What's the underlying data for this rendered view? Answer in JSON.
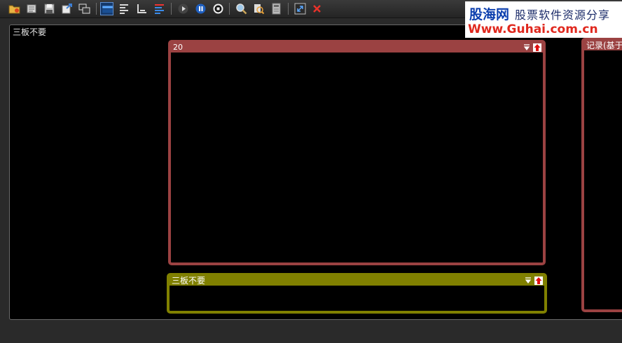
{
  "toolbar": {
    "buttons": [
      {
        "icon": "open-folder-icon"
      },
      {
        "icon": "open-icon"
      },
      {
        "icon": "save-icon"
      },
      {
        "icon": "export-icon"
      },
      {
        "icon": "window-switch-icon"
      },
      {
        "icon": "layout-full-icon",
        "active": true
      },
      {
        "icon": "align-left-icon"
      },
      {
        "icon": "align-bottom-icon"
      },
      {
        "icon": "bars-color-icon"
      },
      {
        "icon": "play-icon"
      },
      {
        "icon": "pause-icon"
      },
      {
        "icon": "stop-icon"
      },
      {
        "icon": "zoom-icon"
      },
      {
        "icon": "find-icon"
      },
      {
        "icon": "calculator-icon"
      },
      {
        "icon": "expand-icon"
      },
      {
        "icon": "close-icon"
      }
    ]
  },
  "logo": {
    "name": "股海网",
    "tagline": "股票软件资源分享",
    "url": "Www.Guhai.com.cn"
  },
  "workspace": {
    "title": "三板不要"
  },
  "panels": {
    "main": {
      "title": "20"
    },
    "bottom": {
      "title": "三板不要"
    },
    "right": {
      "title": "记录(基于"
    }
  },
  "colors": {
    "panel_red": "#9b4242",
    "panel_olive": "#808000",
    "background": "#000000"
  }
}
